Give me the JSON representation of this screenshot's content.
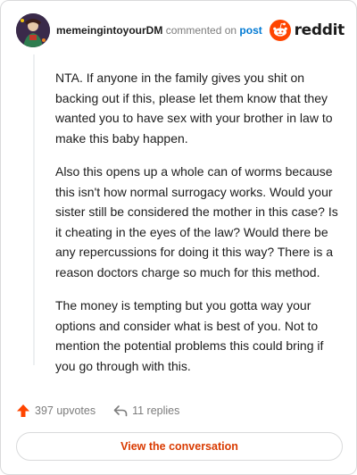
{
  "header": {
    "username": "memeingintoyourDM",
    "commented_on": "commented on",
    "post_link": "post",
    "brand": "reddit"
  },
  "comment": {
    "paragraphs": [
      "NTA. If anyone in the family gives you shit on backing out if this, please let them know that they wanted you to have sex with your brother in law to make this baby happen.",
      "Also this opens up a whole can of worms because this isn't how normal surrogacy works. Would your sister still be considered the mother in this case? Is it cheating in the eyes of the law? Would there be any repercussions for doing it this way? There is a reason doctors charge so much for this method.",
      "The money is tempting but you gotta way your options and consider what is best of you. Not to mention the potential problems this could bring if you go through with this."
    ]
  },
  "actions": {
    "upvotes": "397 upvotes",
    "replies": "11 replies"
  },
  "cta": {
    "label": "View the conversation"
  },
  "colors": {
    "brand_orange": "#ff4500",
    "link_blue": "#0079d3",
    "cta_text": "#d93a00"
  }
}
